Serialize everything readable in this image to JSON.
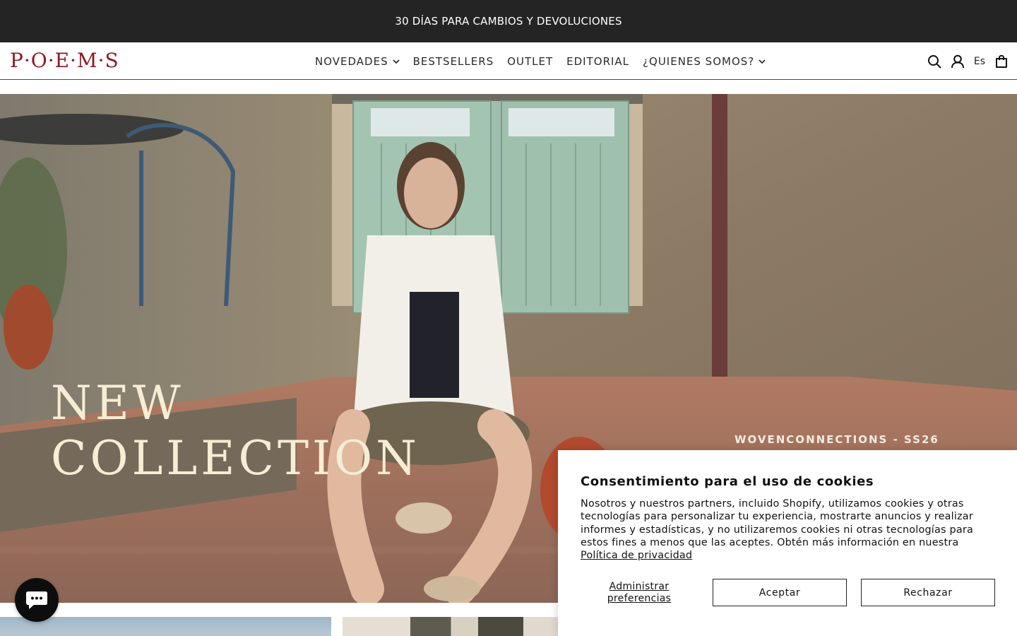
{
  "announcement": {
    "text": "30 DÍAS PARA CAMBIOS Y DEVOLUCIONES"
  },
  "header": {
    "logo": "P·O·E·M·S",
    "nav": [
      {
        "label": "NOVEDADES",
        "has_dropdown": true
      },
      {
        "label": "BESTSELLERS",
        "has_dropdown": false
      },
      {
        "label": "OUTLET",
        "has_dropdown": false
      },
      {
        "label": "EDITORIAL",
        "has_dropdown": false
      },
      {
        "label": "¿QUIENES SOMOS?",
        "has_dropdown": true
      }
    ],
    "icons": [
      "search-icon",
      "account-icon",
      "cart-icon"
    ],
    "language": "Es",
    "accent_color": "#8e1b22"
  },
  "hero": {
    "title_line1": "NEW",
    "title_line2": "COLLECTION",
    "subtitle": "WOVENCONNECTIONS - SS26"
  },
  "chat": {
    "icon": "chat-icon",
    "color": "#0d0d0d"
  },
  "cookie_banner": {
    "title": "Consentimiento para el uso de cookies",
    "body": "Nosotros y nuestros partners, incluido Shopify, utilizamos cookies y otras tecnologías para personalizar tu experiencia, mostrarte anuncios y realizar informes y estadísticas, y no utilizaremos cookies ni otras tecnologías para estos fines a menos que las aceptes. Obtén más información en nuestra",
    "policy_link": "Política de privacidad",
    "manage_label": "Administrar preferencias",
    "accept_label": "Aceptar",
    "reject_label": "Rechazar"
  }
}
